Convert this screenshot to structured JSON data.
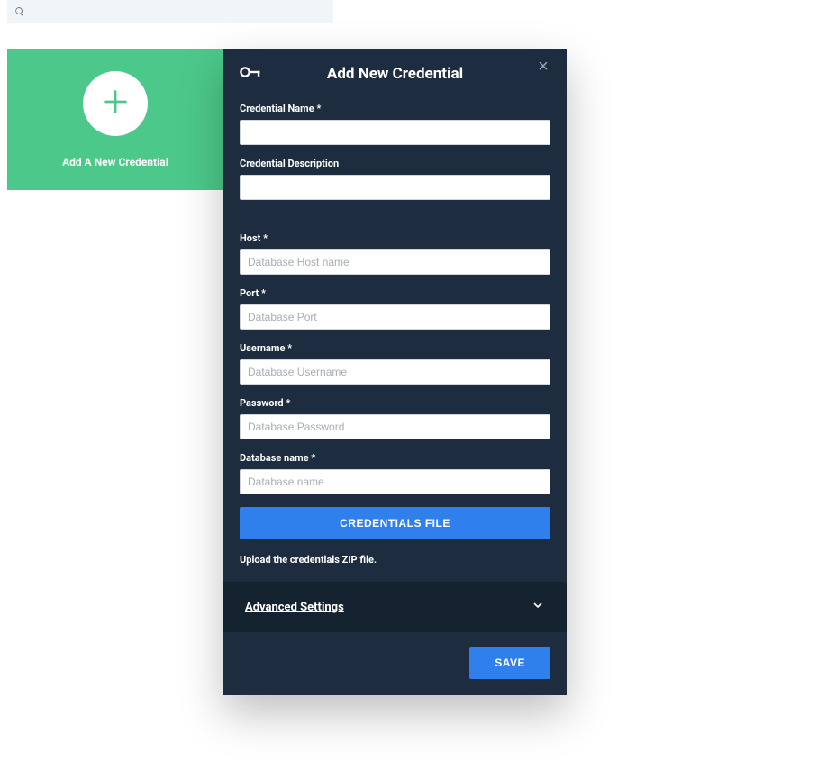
{
  "search": {
    "placeholder": ""
  },
  "addCard": {
    "label": "Add A New Credential"
  },
  "modal": {
    "title": "Add New Credential",
    "fields": {
      "name": {
        "label": "Credential Name *",
        "placeholder": ""
      },
      "description": {
        "label": "Credential Description",
        "placeholder": ""
      },
      "host": {
        "label": "Host *",
        "placeholder": "Database Host name"
      },
      "port": {
        "label": "Port *",
        "placeholder": "Database Port"
      },
      "username": {
        "label": "Username *",
        "placeholder": "Database Username"
      },
      "password": {
        "label": "Password *",
        "placeholder": "Database Password"
      },
      "dbname": {
        "label": "Database name *",
        "placeholder": "Database name"
      }
    },
    "credentialsFileButton": "CREDENTIALS FILE",
    "uploadHint": "Upload the credentials ZIP file.",
    "advancedLabel": "Advanced Settings",
    "saveLabel": "SAVE"
  }
}
